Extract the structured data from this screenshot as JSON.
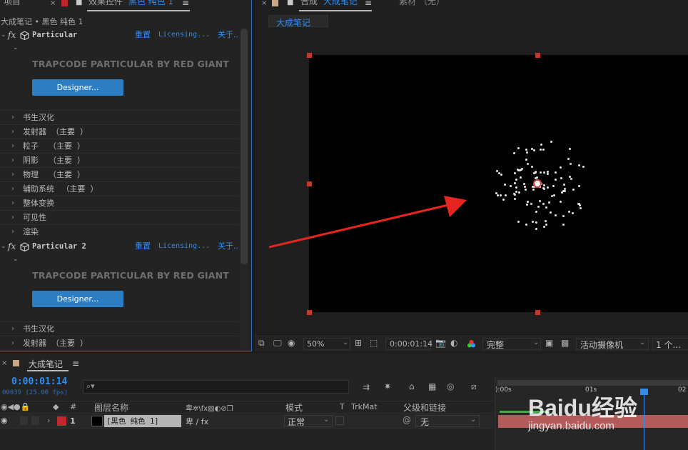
{
  "left_panel": {
    "tab_project": "项目",
    "tab_effects_prefix": "效果控件",
    "tab_effects_layer": "黑色 纯色 1",
    "breadcrumb": "大成笔记 • 黑色 纯色 1",
    "effects": [
      {
        "name": "Particular",
        "reset": "重置",
        "licensing": "Licensing...",
        "about": "关于...",
        "brand": "TRAPCODE PARTICULAR BY RED GIANT",
        "designer": "Designer...",
        "groups": [
          "书生汉化",
          "发射器  （主要  ）",
          "粒子    （主要  ）",
          "阴影    （主要  ）",
          "物理    （主要  ）",
          "辅助系统   （主要  ）",
          "整体变换",
          "可见性",
          "渲染"
        ]
      },
      {
        "name": "Particular 2",
        "reset": "重置",
        "licensing": "Licensing...",
        "about": "关于...",
        "brand": "TRAPCODE PARTICULAR BY RED GIANT",
        "designer": "Designer...",
        "groups": [
          "书生汉化",
          "发射器  （主要  ）"
        ]
      }
    ]
  },
  "comp_panel": {
    "tab_comp_prefix": "合成",
    "tab_comp_name": "大成笔记",
    "tab_footage": "素材 （无）",
    "comp_tag": "大成笔记",
    "zoom": "50%",
    "timecode": "0:00:01:14",
    "resolution": "完整",
    "camera": "活动摄像机",
    "views": "1 个..."
  },
  "timeline": {
    "comp_name": "大成笔记",
    "timecode": "0:00:01:14",
    "frame_info": "00039 (25.00 fps)",
    "search_placeholder": "",
    "columns": {
      "num": "#",
      "layer_name": "图层名称",
      "mode": "模式",
      "t": "T",
      "trkmat": "TrkMat",
      "parent": "父级和链接"
    },
    "layers": [
      {
        "index": "1",
        "name": "[黑色 纯色 1]",
        "mode": "正常",
        "parent": "无",
        "label_color": "#c1272d"
      }
    ],
    "ruler": [
      "):00s",
      "01s",
      "02"
    ]
  },
  "watermark": {
    "brand": "Baidu经验",
    "url": "jingyan.baidu.com"
  },
  "colors": {
    "accent": "#2f8df0",
    "designer_button": "#2d7ec3",
    "handle": "#c0392b",
    "arrow": "#e52620",
    "layer_bar": "#b35a5a"
  }
}
